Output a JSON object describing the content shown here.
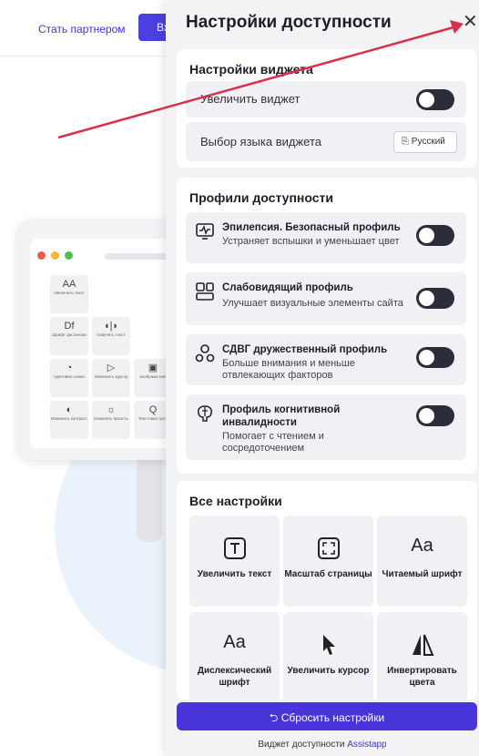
{
  "site": {
    "partner_link": "Стать партнером",
    "login_button": "Вх"
  },
  "illustration": {
    "tiles": [
      {
        "icon": "AA",
        "label": "Увеличить текст"
      },
      {
        "icon": "Df",
        "label": "Шрифт дислексии"
      },
      {
        "icon": "◖|◗",
        "label": "Озвучить текст"
      },
      {
        "icon": "◔",
        "label": "Цветовая схема"
      },
      {
        "icon": "▷",
        "label": "Увеличить курсор"
      },
      {
        "icon": "▣",
        "label": "изображе ния"
      },
      {
        "icon": "◐",
        "label": "Изменить контраст"
      },
      {
        "icon": "☼",
        "label": "Изменить яркость"
      },
      {
        "icon": "Q",
        "label": "Текстовая лупа"
      }
    ]
  },
  "panel": {
    "title": "Настройки доступности",
    "close_icon": "close-icon",
    "widget_settings": {
      "title": "Настройки виджета",
      "enlarge_widget": "Увеличить виджет",
      "language_label": "Выбор языка виджета",
      "language_value": "Русский"
    },
    "profiles": {
      "title": "Профили доступности",
      "items": [
        {
          "title": "Эпилепсия. Безопасный профиль",
          "desc": "Устраняет вспышки и уменьшает цвет",
          "icon": "monitor-pulse-icon"
        },
        {
          "title": "Слабовидящий профиль",
          "desc": "Улучшает визуальные элементы сайта",
          "icon": "layout-icon"
        },
        {
          "title": "СДВГ дружественный профиль",
          "desc": "Больше внимания и меньше отвлекающих факторов",
          "icon": "attention-icon"
        },
        {
          "title": "Профиль когнитивной инвалидности",
          "desc": "Помогает с чтением и сосредоточением",
          "icon": "brain-icon"
        }
      ]
    },
    "all_settings": {
      "title": "Все настройки",
      "tiles": [
        {
          "label": "Увеличить текст",
          "icon": "text-box-icon"
        },
        {
          "label": "Масштаб страницы",
          "icon": "zoom-page-icon"
        },
        {
          "label": "Читаемый шрифт",
          "icon": "font-aa-icon"
        },
        {
          "label": "Дислексический шрифт",
          "icon": "font-aa-icon"
        },
        {
          "label": "Увеличить курсор",
          "icon": "cursor-icon"
        },
        {
          "label": "Инвертировать цвета",
          "icon": "invert-icon"
        }
      ]
    },
    "reset_button": "Сбросить настройки",
    "footer": {
      "text": "Виджет доступности ",
      "brand": "Assistapp"
    }
  },
  "colors": {
    "accent": "#4735d9",
    "toggle_dark": "#2b2d3b",
    "arrow": "#d9304a",
    "panel_bg": "#f3f3f6"
  }
}
